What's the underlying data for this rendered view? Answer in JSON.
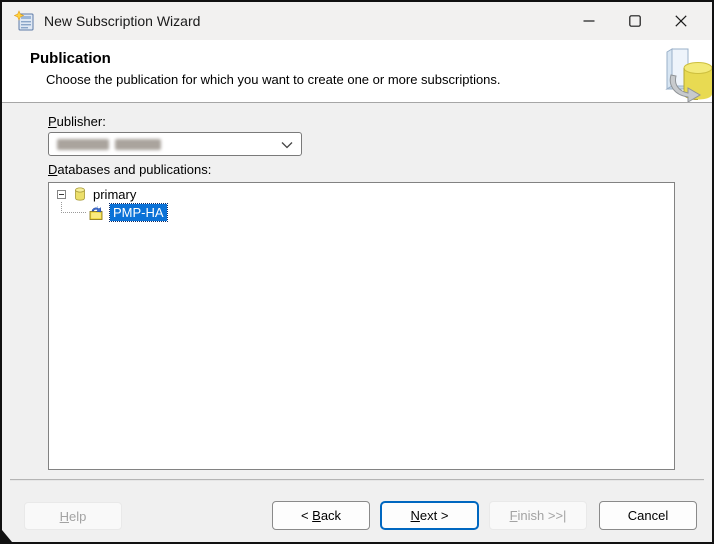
{
  "window": {
    "title": "New Subscription Wizard"
  },
  "header": {
    "title": "Publication",
    "description": "Choose the publication for which you want to create one or more subscriptions."
  },
  "publisher": {
    "label_mnemonic": "P",
    "label_rest": "ublisher:",
    "value": "",
    "value_redacted": true
  },
  "databases_label": {
    "mnemonic": "D",
    "rest": "atabases and publications:"
  },
  "tree": {
    "items": [
      {
        "label": "primary",
        "icon": "database-icon",
        "expanded": true,
        "selected": false
      },
      {
        "label": "PMP-HA",
        "icon": "publication-icon",
        "expanded": false,
        "selected": true
      }
    ]
  },
  "buttons": {
    "help": {
      "mnemonic": "H",
      "rest": "elp",
      "enabled": false
    },
    "back": {
      "pre": "< ",
      "mnemonic": "B",
      "rest": "ack",
      "enabled": true
    },
    "next": {
      "mnemonic": "N",
      "rest": "ext >",
      "enabled": true,
      "focused": true
    },
    "finish": {
      "mnemonic": "F",
      "rest": "inish >>|",
      "enabled": false
    },
    "cancel": {
      "label": "Cancel",
      "enabled": true
    }
  },
  "colors": {
    "selection_blue": "#0b72d7",
    "focus_border_blue": "#0067c0",
    "dialog_background": "#f0f0f0",
    "header_background": "#ffffff",
    "disabled_text": "#a3a3a3"
  }
}
